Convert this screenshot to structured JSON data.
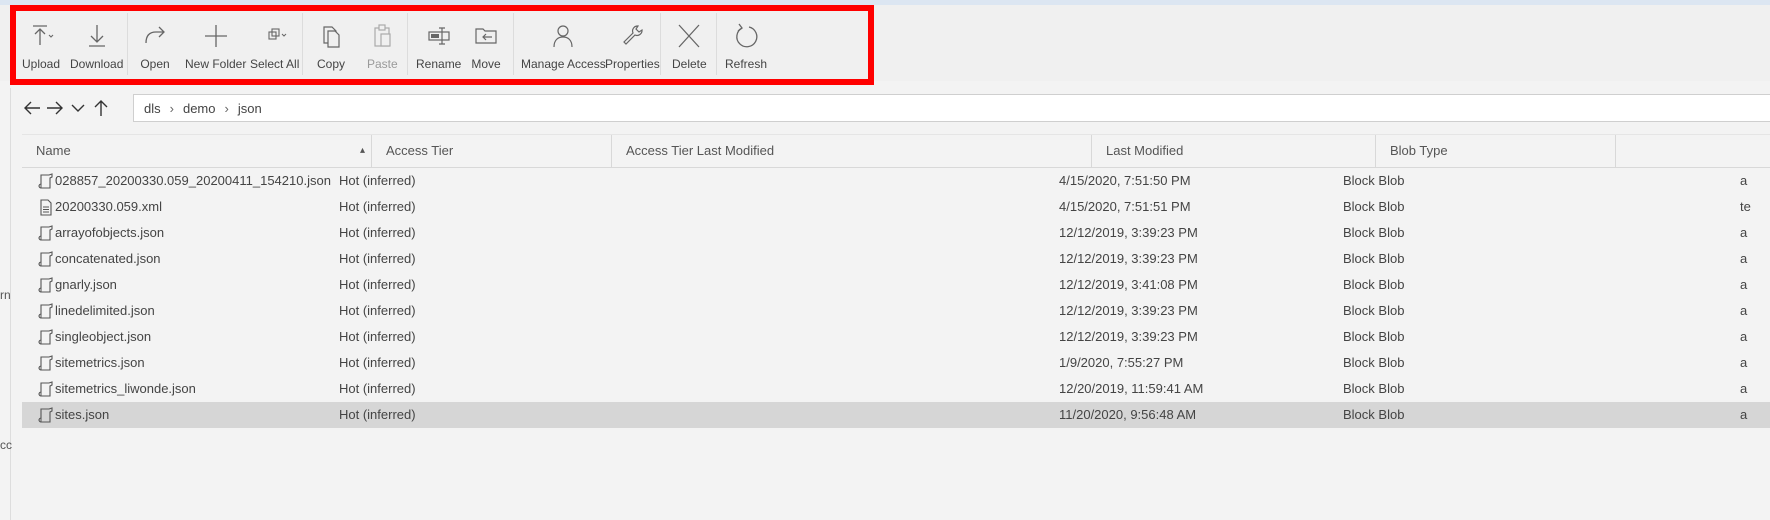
{
  "toolbar": {
    "upload": "Upload",
    "download": "Download",
    "open": "Open",
    "new_folder": "New Folder",
    "select_all": "Select All",
    "copy": "Copy",
    "paste": "Paste",
    "rename": "Rename",
    "move": "Move",
    "manage_access": "Manage Access",
    "properties": "Properties",
    "delete": "Delete",
    "refresh": "Refresh"
  },
  "left_fragments": [
    "rn",
    "cc"
  ],
  "breadcrumb": [
    "dls",
    "demo",
    "json"
  ],
  "columns": [
    "Name",
    "Access Tier",
    "Access Tier Last Modified",
    "Last Modified",
    "Blob Type"
  ],
  "rows": [
    {
      "name": "028857_20200330.059_20200411_154210.json",
      "tier": "Hot (inferred)",
      "modified": "4/15/2020, 7:51:50 PM",
      "type": "Block Blob",
      "extra": "a",
      "icon": "json-file-icon"
    },
    {
      "name": "20200330.059.xml",
      "tier": "Hot (inferred)",
      "modified": "4/15/2020, 7:51:51 PM",
      "type": "Block Blob",
      "extra": "te",
      "icon": "document-file-icon"
    },
    {
      "name": "arrayofobjects.json",
      "tier": "Hot (inferred)",
      "modified": "12/12/2019, 3:39:23 PM",
      "type": "Block Blob",
      "extra": "a",
      "icon": "json-file-icon"
    },
    {
      "name": "concatenated.json",
      "tier": "Hot (inferred)",
      "modified": "12/12/2019, 3:39:23 PM",
      "type": "Block Blob",
      "extra": "a",
      "icon": "json-file-icon"
    },
    {
      "name": "gnarly.json",
      "tier": "Hot (inferred)",
      "modified": "12/12/2019, 3:41:08 PM",
      "type": "Block Blob",
      "extra": "a",
      "icon": "json-file-icon"
    },
    {
      "name": "linedelimited.json",
      "tier": "Hot (inferred)",
      "modified": "12/12/2019, 3:39:23 PM",
      "type": "Block Blob",
      "extra": "a",
      "icon": "json-file-icon"
    },
    {
      "name": "singleobject.json",
      "tier": "Hot (inferred)",
      "modified": "12/12/2019, 3:39:23 PM",
      "type": "Block Blob",
      "extra": "a",
      "icon": "json-file-icon"
    },
    {
      "name": "sitemetrics.json",
      "tier": "Hot (inferred)",
      "modified": "1/9/2020, 7:55:27 PM",
      "type": "Block Blob",
      "extra": "a",
      "icon": "json-file-icon"
    },
    {
      "name": "sitemetrics_liwonde.json",
      "tier": "Hot (inferred)",
      "modified": "12/20/2019, 11:59:41 AM",
      "type": "Block Blob",
      "extra": "a",
      "icon": "json-file-icon"
    },
    {
      "name": "sites.json",
      "tier": "Hot (inferred)",
      "modified": "11/20/2020, 9:56:48 AM",
      "type": "Block Blob",
      "extra": "a",
      "icon": "json-file-icon",
      "selected": true
    }
  ],
  "colors": {
    "highlight": "#ff0000",
    "selected_row": "#d6d6d6",
    "background": "#f3f3f3"
  }
}
